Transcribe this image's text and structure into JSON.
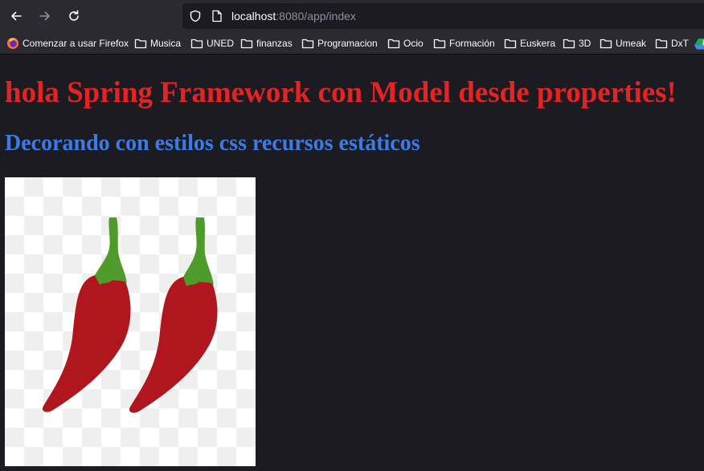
{
  "browser": {
    "url_host": "localhost",
    "url_rest": ":8080/app/index"
  },
  "bookmarks": [
    {
      "label": "Comenzar a usar Firefox",
      "icon": "firefox-icon"
    },
    {
      "label": "Musica",
      "icon": "folder-icon"
    },
    {
      "label": "UNED",
      "icon": "folder-icon"
    },
    {
      "label": "finanzas",
      "icon": "folder-icon"
    },
    {
      "label": "Programacion",
      "icon": "folder-icon"
    },
    {
      "label": "Ocio",
      "icon": "folder-icon"
    },
    {
      "label": "Formación",
      "icon": "folder-icon"
    },
    {
      "label": "Euskera",
      "icon": "folder-icon"
    },
    {
      "label": "3D",
      "icon": "folder-icon"
    },
    {
      "label": "Umeak",
      "icon": "folder-icon"
    },
    {
      "label": "DxT",
      "icon": "folder-icon"
    }
  ],
  "page": {
    "title": "hola Spring Framework con Model desde properties!",
    "subtitle": "Decorando con estilos css recursos estáticos",
    "title_color": "#e52323",
    "subtitle_color": "#3b7be8"
  }
}
